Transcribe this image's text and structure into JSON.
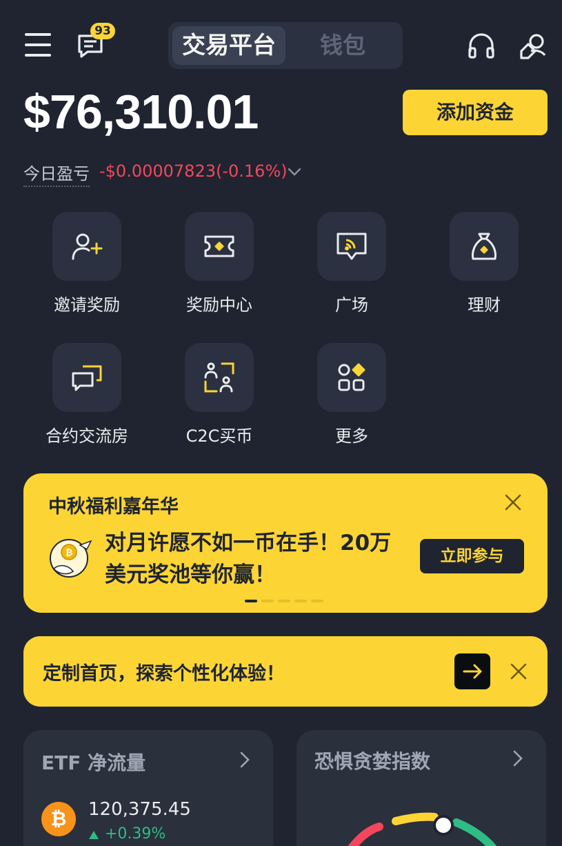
{
  "header": {
    "message_badge": "93",
    "tabs": [
      {
        "label": "交易平台",
        "active": true
      },
      {
        "label": "钱包",
        "active": false
      }
    ]
  },
  "account": {
    "balance": "$76,310.01",
    "add_funds_label": "添加资金",
    "pnl_label": "今日盈亏",
    "pnl_value": "-$0.00007823(-0.16%)"
  },
  "quick_actions": [
    {
      "label": "邀请奖励",
      "icon": "invite-user-icon"
    },
    {
      "label": "奖励中心",
      "icon": "ticket-icon"
    },
    {
      "label": "广场",
      "icon": "broadcast-icon"
    },
    {
      "label": "理财",
      "icon": "money-bag-icon"
    },
    {
      "label": "合约交流房",
      "icon": "chat-room-icon"
    },
    {
      "label": "C2C买币",
      "icon": "c2c-users-icon"
    },
    {
      "label": "更多",
      "icon": "more-grid-icon"
    }
  ],
  "promo_banner": {
    "title": "中秋福利嘉年华",
    "text": "对月许愿不如一币在手！20万美元奖池等你赢！",
    "button": "立即参与",
    "page_count": 5,
    "active_page": 1
  },
  "customize_banner": {
    "text": "定制首页，探索个性化体验！"
  },
  "cards": {
    "etf": {
      "title": "ETF 净流量",
      "value": "120,375.45",
      "change": "+0.39%"
    },
    "fear_greed": {
      "title": "恐惧贪婪指数"
    }
  },
  "colors": {
    "background": "#1f2430",
    "accent": "#fcd535",
    "negative": "#f6465d",
    "positive": "#2ebd85"
  }
}
